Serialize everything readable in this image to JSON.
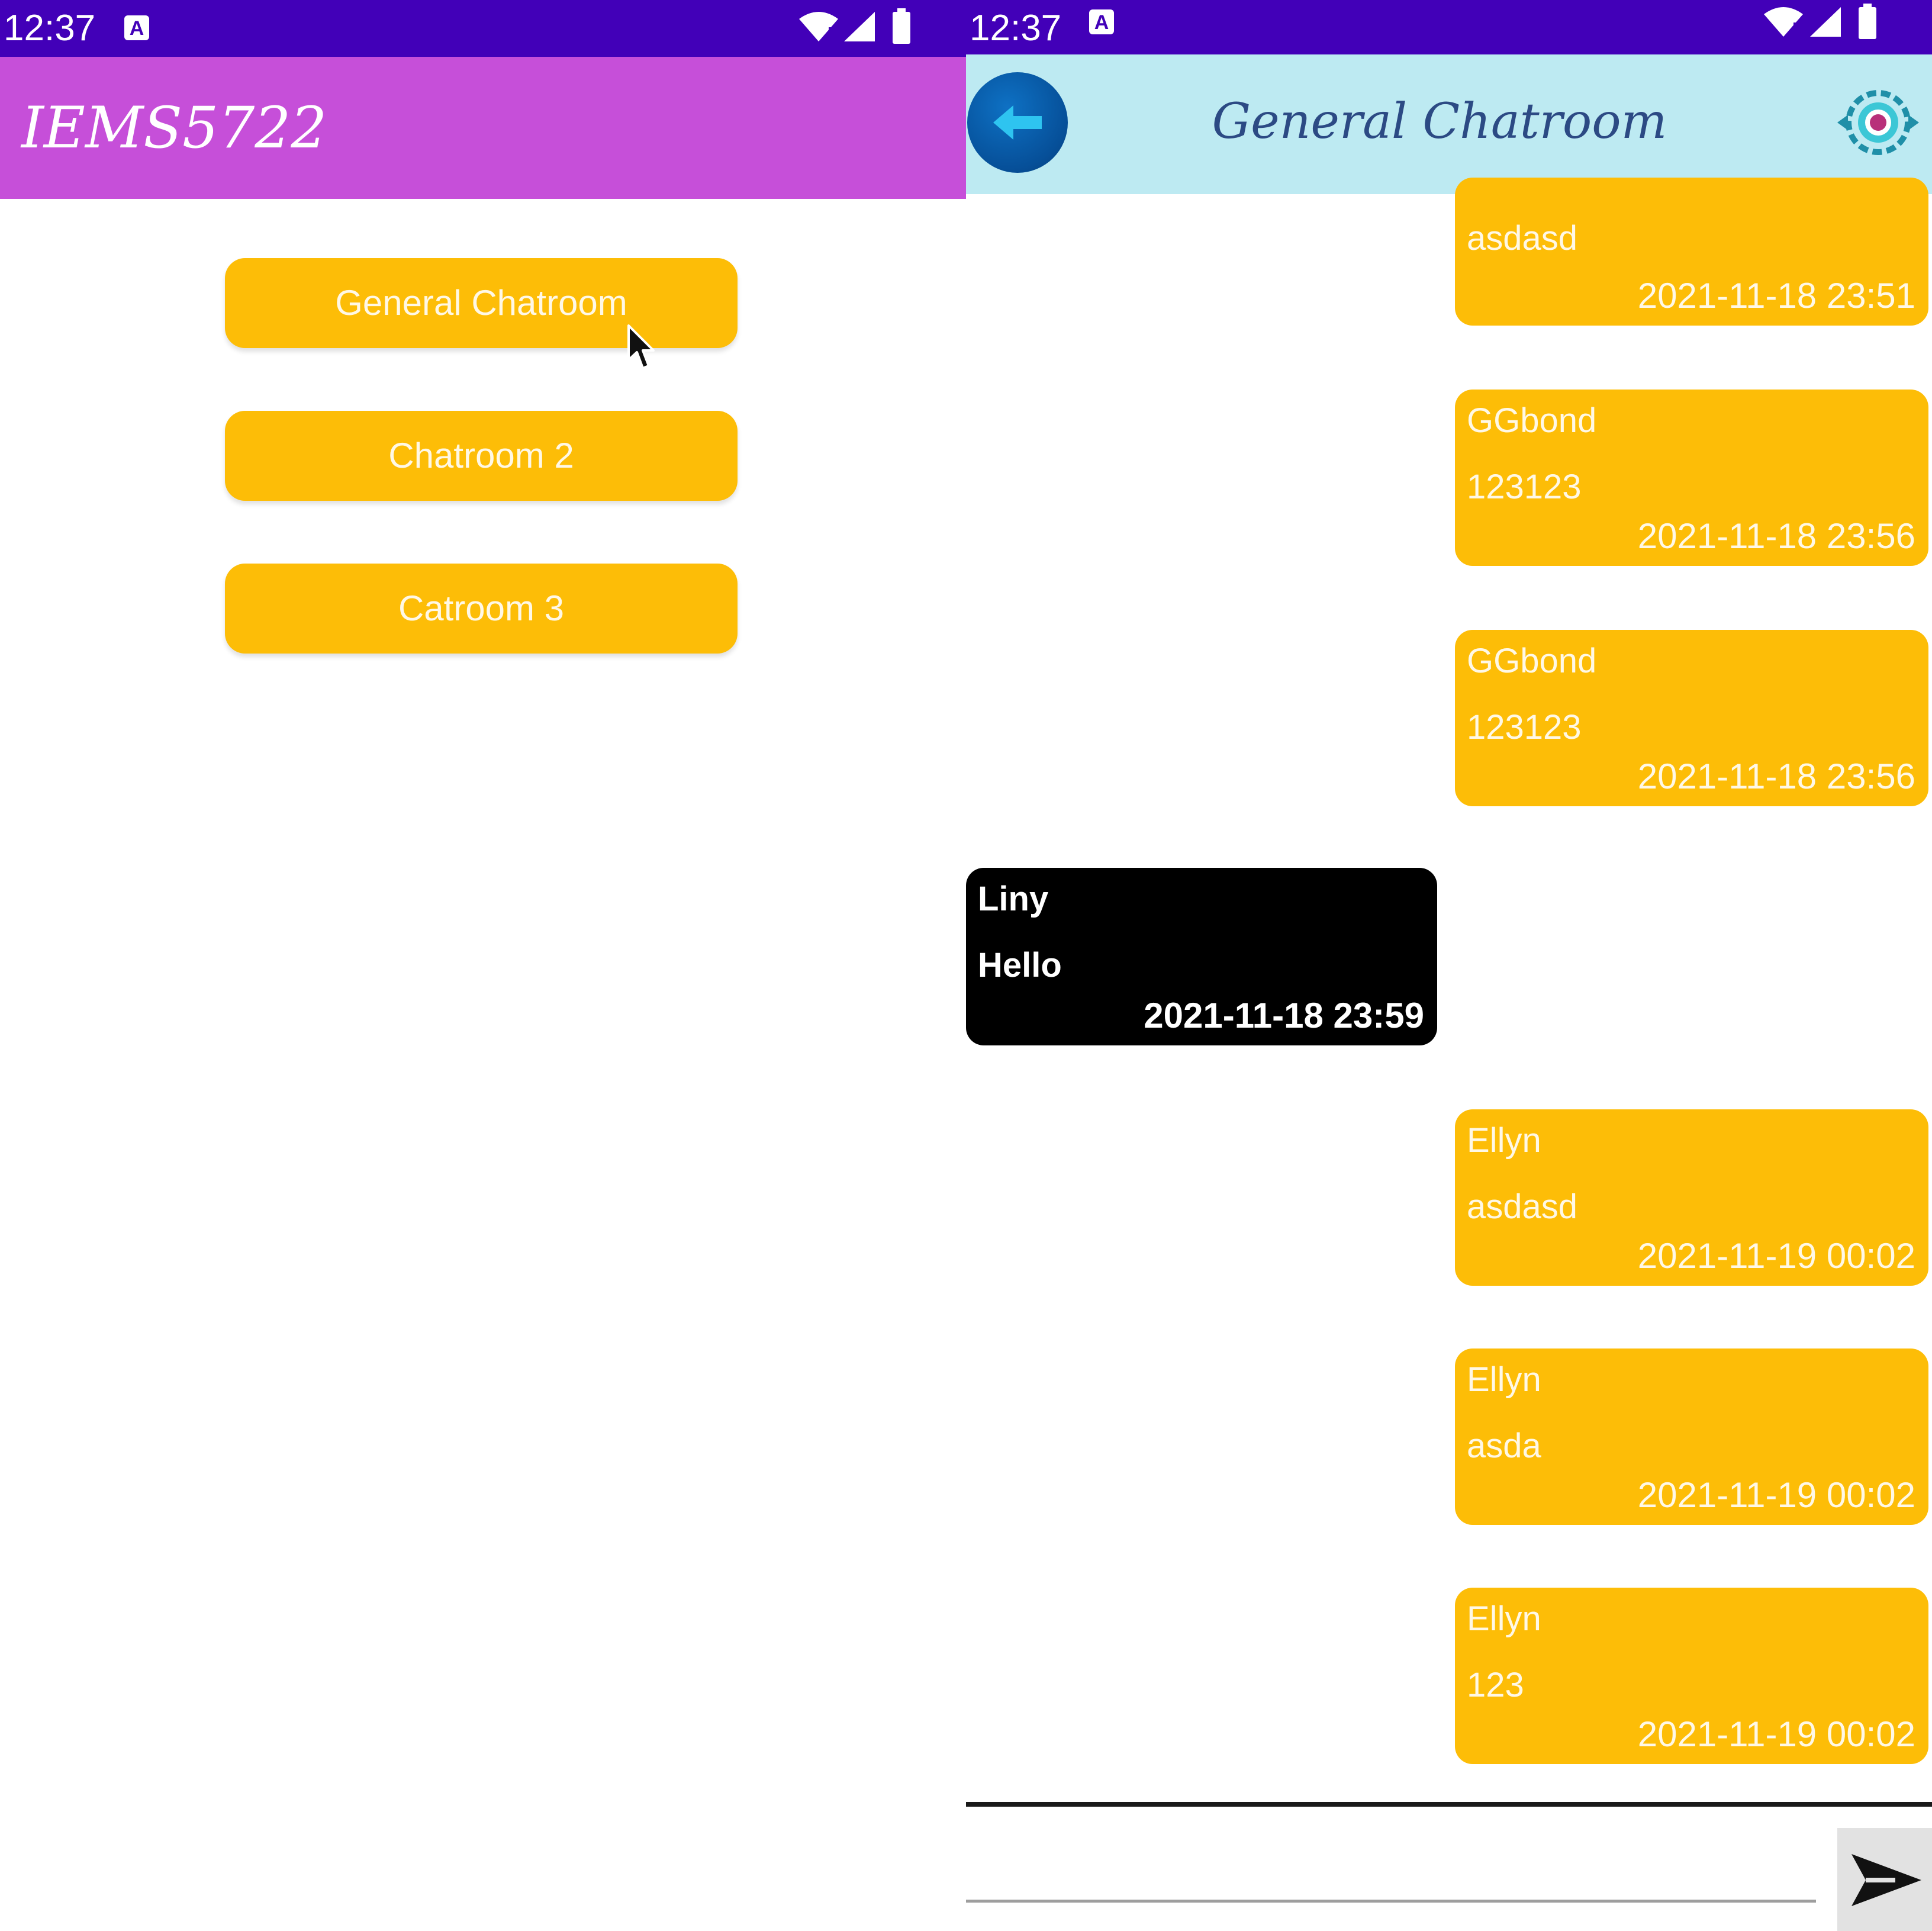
{
  "status_bar": {
    "time": "12:37",
    "notification_icon_letter": "A"
  },
  "left_screen": {
    "app_title": "IEMS5722",
    "rooms": [
      {
        "label": "General Chatroom"
      },
      {
        "label": "Chatroom 2"
      },
      {
        "label": "Catroom 3"
      }
    ]
  },
  "right_screen": {
    "title": "General Chatroom",
    "messages": [
      {
        "sender": "",
        "text": "asdasd",
        "time": "2021-11-18 23:51",
        "side": "mine"
      },
      {
        "sender": "GGbond",
        "text": "123123",
        "time": "2021-11-18 23:56",
        "side": "mine"
      },
      {
        "sender": "GGbond",
        "text": "123123",
        "time": "2021-11-18 23:56",
        "side": "mine"
      },
      {
        "sender": "Liny",
        "text": "Hello",
        "time": "2021-11-18 23:59",
        "side": "theirs"
      },
      {
        "sender": "Ellyn",
        "text": "asdasd",
        "time": "2021-11-19 00:02",
        "side": "mine"
      },
      {
        "sender": "Ellyn",
        "text": "asda",
        "time": "2021-11-19 00:02",
        "side": "mine"
      },
      {
        "sender": "Ellyn",
        "text": "123",
        "time": "2021-11-19 00:02",
        "side": "mine"
      }
    ],
    "input": {
      "value": "",
      "placeholder": ""
    }
  },
  "icons": {
    "back": "back-arrow-icon",
    "settings": "settings-gear-icon",
    "send": "send-icon",
    "cursor": "mouse-cursor-icon"
  },
  "colors": {
    "status_bar": "#4200b8",
    "left_app_bar": "#c64fd9",
    "room_button": "#fdbd07",
    "chat_header": "#bdeaf2",
    "my_bubble": "#fdbd07",
    "their_bubble": "#000000",
    "back_button": "#064f98"
  }
}
